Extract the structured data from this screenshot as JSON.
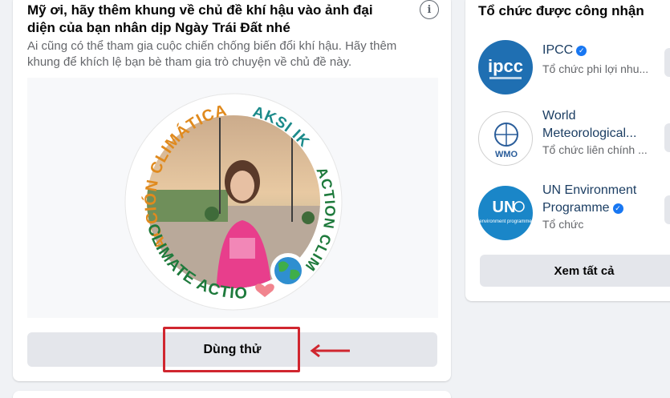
{
  "promo": {
    "title": "Mỹ ơi, hãy thêm khung về chủ đề khí hậu vào ảnh đại diện của bạn nhân dịp Ngày Trái Đất nhé",
    "description": "Ai cũng có thể tham gia cuộc chiến chống biến đổi khí hậu. Hãy thêm khung để khích lệ bạn bè tham gia trò chuyện về chủ đề này.",
    "info_glyph": "i",
    "frame_words": {
      "accion": "ACCIÓN CLIMÁTICA",
      "aksi": "AKSI IKLIM",
      "action_fr": "ACTION CLIMAT",
      "climate": "CLIMATE ACTION"
    },
    "try_button": "Dùng thử"
  },
  "orgs": {
    "title": "Tổ chức được công nhận",
    "items": [
      {
        "name": "IPCC",
        "subtitle": "Tổ chức phi lợi nhu...",
        "logo_text": "ipcc",
        "verified": true
      },
      {
        "name": "World Meteorological...",
        "subtitle": "Tổ chức liên chính ...",
        "logo_text": "WMO",
        "verified": false
      },
      {
        "name": "UN Environment Programme",
        "subtitle": "Tổ chức",
        "logo_text": "UN",
        "logo_sub": "environment programme",
        "verified": true
      }
    ],
    "see_all": "Xem tất cả"
  },
  "colors": {
    "highlight": "#d0262f",
    "frame_green": "#1e7a3c",
    "frame_orange": "#e08a1e",
    "frame_teal": "#1b8a8a",
    "ipcc_blue": "#1f6fb2",
    "un_blue": "#1a86c8"
  }
}
